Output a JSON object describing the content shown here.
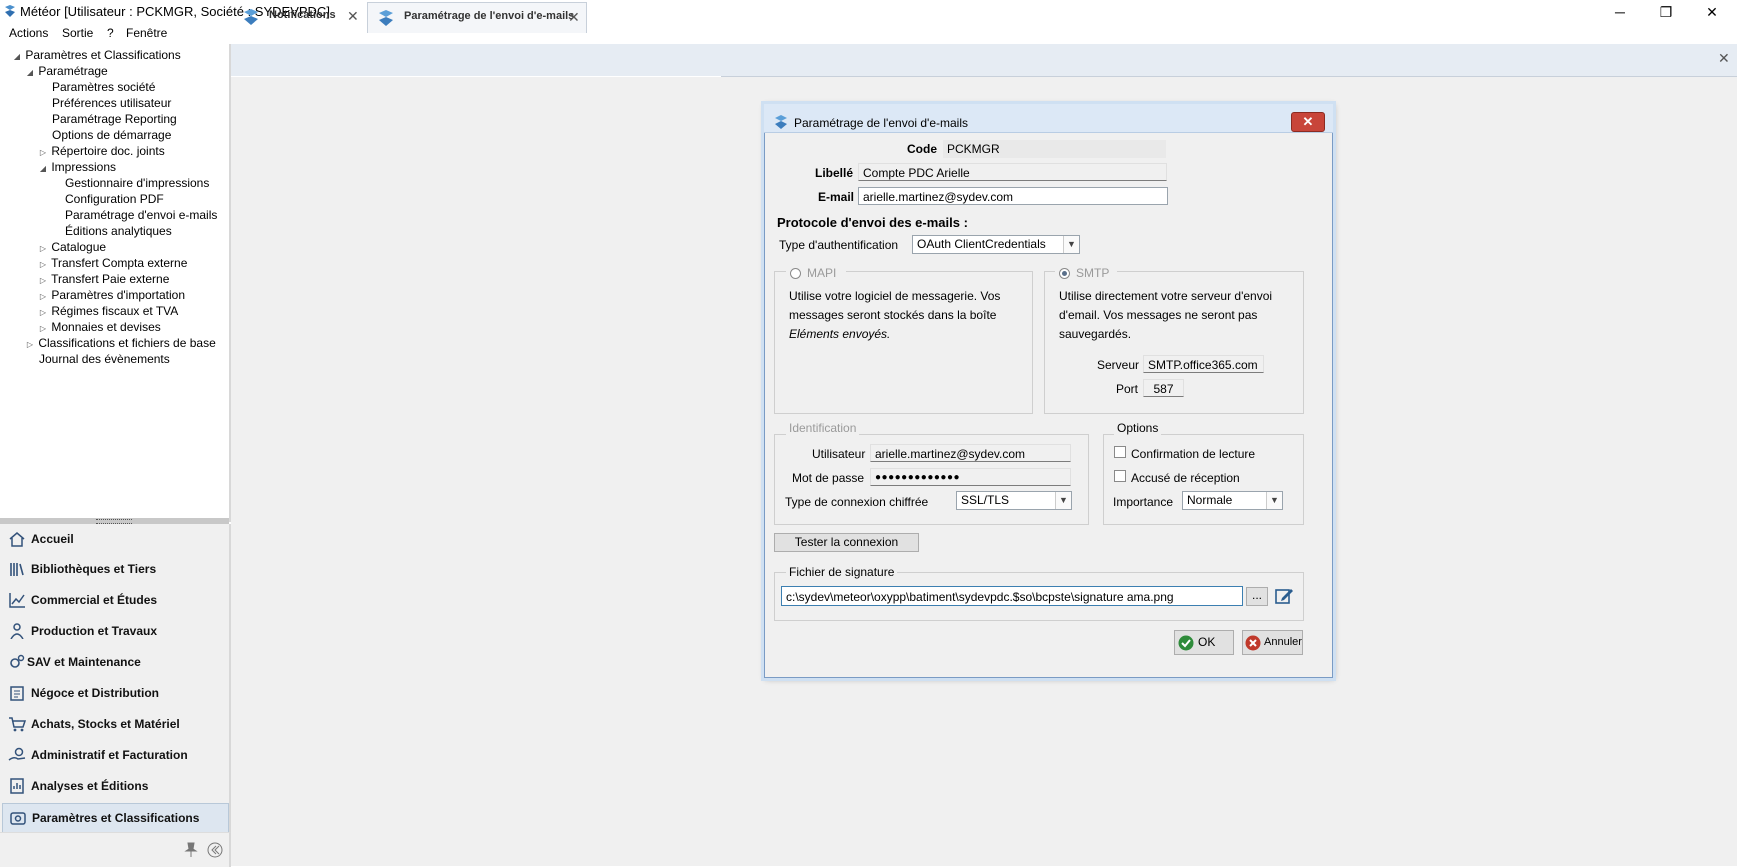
{
  "window": {
    "title": "Météor [Utilisateur : PCKMGR, Société : SYDEVPDC]",
    "minimize": "─",
    "restore": "❐",
    "close": "✕"
  },
  "menu": [
    "Actions",
    "Sortie",
    "?",
    "Fenêtre"
  ],
  "tree": [
    {
      "label": "Paramètres et Classifications",
      "toggle": "◢"
    },
    {
      "label": "Paramétrage",
      "toggle": "◢"
    },
    {
      "label": "Paramètres société",
      "toggle": ""
    },
    {
      "label": "Préférences utilisateur",
      "toggle": ""
    },
    {
      "label": "Paramétrage Reporting",
      "toggle": ""
    },
    {
      "label": "Options de démarrage",
      "toggle": ""
    },
    {
      "label": "Répertoire doc. joints",
      "toggle": "▷"
    },
    {
      "label": "Impressions",
      "toggle": "◢"
    },
    {
      "label": "Gestionnaire d'impressions",
      "toggle": ""
    },
    {
      "label": "Configuration PDF",
      "toggle": ""
    },
    {
      "label": "Paramétrage d'envoi e-mails",
      "toggle": ""
    },
    {
      "label": "Éditions analytiques",
      "toggle": ""
    },
    {
      "label": "Catalogue",
      "toggle": "▷"
    },
    {
      "label": "Transfert Compta externe",
      "toggle": "▷"
    },
    {
      "label": "Transfert Paie externe",
      "toggle": "▷"
    },
    {
      "label": "Paramètres d'importation",
      "toggle": "▷"
    },
    {
      "label": "Régimes fiscaux et TVA",
      "toggle": "▷"
    },
    {
      "label": "Monnaies et devises",
      "toggle": "▷"
    },
    {
      "label": "Classifications et fichiers de base",
      "toggle": "▷"
    },
    {
      "label": "Journal des évènements",
      "toggle": ""
    }
  ],
  "nav": [
    {
      "label": "Accueil",
      "icon": "home-icon"
    },
    {
      "label": "Bibliothèques et Tiers",
      "icon": "books-icon"
    },
    {
      "label": "Commercial et Études",
      "icon": "chart-icon"
    },
    {
      "label": "Production et Travaux",
      "icon": "worker-icon"
    },
    {
      "label": "SAV et Maintenance",
      "icon": "gears-icon"
    },
    {
      "label": "Négoce et Distribution",
      "icon": "clipboard-icon"
    },
    {
      "label": "Achats, Stocks et Matériel",
      "icon": "cart-icon"
    },
    {
      "label": "Administratif et Facturation",
      "icon": "hand-coin-icon"
    },
    {
      "label": "Analyses et Éditions",
      "icon": "report-icon"
    },
    {
      "label": "Paramètres et Classifications",
      "icon": "settings-icon"
    }
  ],
  "tabs": [
    {
      "label": "Notifications"
    },
    {
      "label": "Paramétrage de l'envoi d'e-mails"
    }
  ],
  "dialog": {
    "title": "Paramétrage de l'envoi d'e-mails",
    "close": "✕",
    "code_label": "Code",
    "code_value": "PCKMGR",
    "libelle_label": "Libellé",
    "libelle_value": "Compte PDC Arielle",
    "email_label": "E-mail",
    "email_value": "arielle.martinez@sydev.com",
    "protocol_heading": "Protocole d'envoi des e-mails :",
    "auth_label": "Type d'authentification",
    "auth_value": "OAuth ClientCredentials",
    "mapi": {
      "label": "MAPI",
      "line1": "Utilise votre logiciel de messagerie. Vos",
      "line2": "messages seront stockés dans la boîte",
      "line3": "Eléments envoyés."
    },
    "smtp": {
      "label": "SMTP",
      "line1": "Utilise directement votre serveur d'envoi",
      "line2": "d'email. Vos messages ne seront pas",
      "line3": "sauvegardés.",
      "server_label": "Serveur",
      "server_value": "SMTP.office365.com",
      "port_label": "Port",
      "port_value": "587"
    },
    "identification": {
      "legend": "Identification",
      "user_label": "Utilisateur",
      "user_value": "arielle.martinez@sydev.com",
      "password_label": "Mot de passe",
      "password_value": "●●●●●●●●●●●●●",
      "encryption_label": "Type de connexion chiffrée",
      "encryption_value": "SSL/TLS"
    },
    "options": {
      "legend": "Options",
      "read_receipt": "Confirmation de lecture",
      "delivery_receipt": "Accusé de réception",
      "importance_label": "Importance",
      "importance_value": "Normale"
    },
    "test_button": "Tester la connexion",
    "signature": {
      "legend": "Fichier de signature",
      "path": "c:\\sydev\\meteor\\oxypp\\batiment\\sydevpdc.$so\\bcpste\\signature ama.png",
      "browse": "..."
    },
    "ok": "OK",
    "cancel": "Annuler"
  }
}
